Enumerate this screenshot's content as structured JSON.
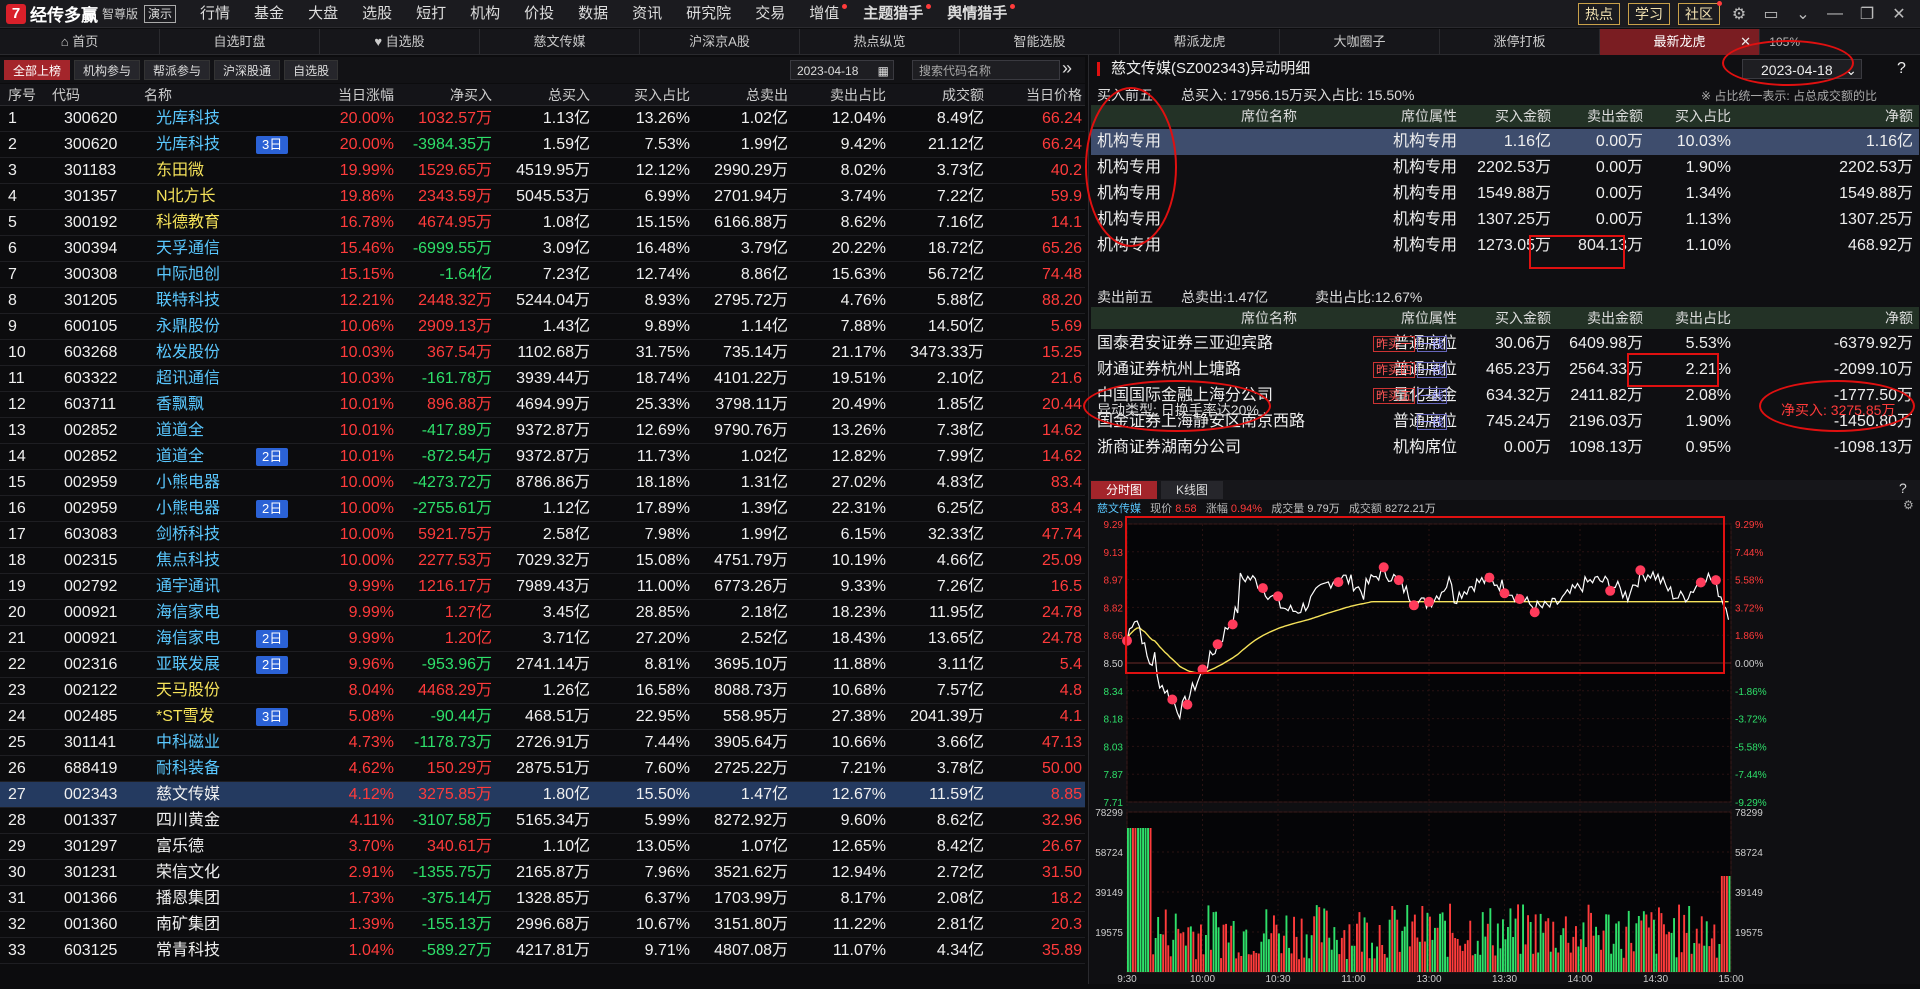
{
  "app": {
    "name": "经传多赢",
    "edition": "智尊版",
    "demo": "演示",
    "menu": [
      "行情",
      "基金",
      "大盘",
      "选股",
      "短打",
      "机构",
      "价投",
      "数据",
      "资讯",
      "研究院",
      "交易",
      "增值",
      "主题猎手",
      "舆情猎手"
    ],
    "menu_dot": [
      false,
      false,
      false,
      false,
      false,
      false,
      false,
      false,
      false,
      false,
      false,
      true,
      true,
      true
    ],
    "right_buttons": [
      "热点",
      "学习",
      "社区"
    ],
    "right_icons": [
      "gear-icon",
      "window-icon",
      "chevron-down-icon",
      "minimize-icon",
      "restore-icon",
      "close-icon"
    ]
  },
  "tabs": [
    "首页",
    "自选盯盘",
    "自选股",
    "慈文传媒",
    "沪深京A股",
    "热点纵览",
    "智能选股",
    "帮派龙虎",
    "大咖圈子",
    "涨停打板",
    "最新龙虎"
  ],
  "tab_icons": [
    "home-icon",
    "",
    "heart-icon",
    "",
    "",
    "",
    "",
    "",
    "",
    "",
    ""
  ],
  "active_tab": 10,
  "zoom": "105%",
  "left_toolbar": {
    "buttons": [
      "全部上榜",
      "机构参与",
      "帮派参与",
      "沪深股通",
      "自选股"
    ],
    "active": 0,
    "date": "2023-04-18",
    "search_placeholder": "搜索代码名称",
    "more": "»"
  },
  "table": {
    "columns": [
      "序号",
      "代码",
      "名称",
      "",
      "当日涨幅",
      "净买入",
      "总买入",
      "买入占比",
      "总卖出",
      "卖出占比",
      "成交额",
      "当日价格"
    ],
    "rows": [
      [
        "1",
        "300620",
        "光库科技",
        "",
        "20.00%",
        "1032.57万",
        "1.13亿",
        "13.26%",
        "1.02亿",
        "12.04%",
        "8.49亿",
        "66.24"
      ],
      [
        "2",
        "300620",
        "光库科技",
        "3日",
        "20.00%",
        "-3984.35万",
        "1.59亿",
        "7.53%",
        "1.99亿",
        "9.42%",
        "21.12亿",
        "66.24"
      ],
      [
        "3",
        "301183",
        "东田微",
        "",
        "19.99%",
        "1529.65万",
        "4519.95万",
        "12.12%",
        "2990.29万",
        "8.02%",
        "3.73亿",
        "40.2"
      ],
      [
        "4",
        "301357",
        "N北方长",
        "",
        "19.86%",
        "2343.59万",
        "5045.53万",
        "6.99%",
        "2701.94万",
        "3.74%",
        "7.22亿",
        "59.9"
      ],
      [
        "5",
        "300192",
        "科德教育",
        "",
        "16.78%",
        "4674.95万",
        "1.08亿",
        "15.15%",
        "6166.88万",
        "8.62%",
        "7.16亿",
        "14.1"
      ],
      [
        "6",
        "300394",
        "天孚通信",
        "",
        "15.46%",
        "-6999.55万",
        "3.09亿",
        "16.48%",
        "3.79亿",
        "20.22%",
        "18.72亿",
        "65.26"
      ],
      [
        "7",
        "300308",
        "中际旭创",
        "",
        "15.15%",
        "-1.64亿",
        "7.23亿",
        "12.74%",
        "8.86亿",
        "15.63%",
        "56.72亿",
        "74.48"
      ],
      [
        "8",
        "301205",
        "联特科技",
        "",
        "12.21%",
        "2448.32万",
        "5244.04万",
        "8.93%",
        "2795.72万",
        "4.76%",
        "5.88亿",
        "88.20"
      ],
      [
        "9",
        "600105",
        "永鼎股份",
        "",
        "10.06%",
        "2909.13万",
        "1.43亿",
        "9.89%",
        "1.14亿",
        "7.88%",
        "14.50亿",
        "5.69"
      ],
      [
        "10",
        "603268",
        "松发股份",
        "",
        "10.03%",
        "367.54万",
        "1102.68万",
        "31.75%",
        "735.14万",
        "21.17%",
        "3473.33万",
        "15.25"
      ],
      [
        "11",
        "603322",
        "超讯通信",
        "",
        "10.03%",
        "-161.78万",
        "3939.44万",
        "18.74%",
        "4101.22万",
        "19.51%",
        "2.10亿",
        "21.6"
      ],
      [
        "12",
        "603711",
        "香飘飘",
        "",
        "10.01%",
        "896.88万",
        "4694.99万",
        "25.33%",
        "3798.11万",
        "20.49%",
        "1.85亿",
        "20.44"
      ],
      [
        "13",
        "002852",
        "道道全",
        "",
        "10.01%",
        "-417.89万",
        "9372.87万",
        "12.69%",
        "9790.76万",
        "13.26%",
        "7.38亿",
        "14.62"
      ],
      [
        "14",
        "002852",
        "道道全",
        "2日",
        "10.01%",
        "-872.54万",
        "9372.87万",
        "11.73%",
        "1.02亿",
        "12.82%",
        "7.99亿",
        "14.62"
      ],
      [
        "15",
        "002959",
        "小熊电器",
        "",
        "10.00%",
        "-4273.72万",
        "8786.86万",
        "18.18%",
        "1.31亿",
        "27.02%",
        "4.83亿",
        "83.4"
      ],
      [
        "16",
        "002959",
        "小熊电器",
        "2日",
        "10.00%",
        "-2755.61万",
        "1.12亿",
        "17.89%",
        "1.39亿",
        "22.31%",
        "6.25亿",
        "83.4"
      ],
      [
        "17",
        "603083",
        "剑桥科技",
        "",
        "10.00%",
        "5921.75万",
        "2.58亿",
        "7.98%",
        "1.99亿",
        "6.15%",
        "32.33亿",
        "47.74"
      ],
      [
        "18",
        "002315",
        "焦点科技",
        "",
        "10.00%",
        "2277.53万",
        "7029.32万",
        "15.08%",
        "4751.79万",
        "10.19%",
        "4.66亿",
        "25.09"
      ],
      [
        "19",
        "002792",
        "通宇通讯",
        "",
        "9.99%",
        "1216.17万",
        "7989.43万",
        "11.00%",
        "6773.26万",
        "9.33%",
        "7.26亿",
        "16.5"
      ],
      [
        "20",
        "000921",
        "海信家电",
        "",
        "9.99%",
        "1.27亿",
        "3.45亿",
        "28.85%",
        "2.18亿",
        "18.23%",
        "11.95亿",
        "24.78"
      ],
      [
        "21",
        "000921",
        "海信家电",
        "2日",
        "9.99%",
        "1.20亿",
        "3.71亿",
        "27.20%",
        "2.52亿",
        "18.43%",
        "13.65亿",
        "24.78"
      ],
      [
        "22",
        "002316",
        "亚联发展",
        "2日",
        "9.96%",
        "-953.96万",
        "2741.14万",
        "8.81%",
        "3695.10万",
        "11.88%",
        "3.11亿",
        "5.4"
      ],
      [
        "23",
        "002122",
        "天马股份",
        "",
        "8.04%",
        "4468.29万",
        "1.26亿",
        "16.58%",
        "8088.73万",
        "10.68%",
        "7.57亿",
        "4.8"
      ],
      [
        "24",
        "002485",
        "*ST雪发",
        "3日",
        "5.08%",
        "-90.44万",
        "468.51万",
        "22.95%",
        "558.95万",
        "27.38%",
        "2041.39万",
        "4.1"
      ],
      [
        "25",
        "301141",
        "中科磁业",
        "",
        "4.73%",
        "-1178.73万",
        "2726.91万",
        "7.44%",
        "3905.64万",
        "10.66%",
        "3.66亿",
        "47.13"
      ],
      [
        "26",
        "688419",
        "耐科装备",
        "",
        "4.62%",
        "150.29万",
        "2875.51万",
        "7.60%",
        "2725.22万",
        "7.21%",
        "3.78亿",
        "50.00"
      ],
      [
        "27",
        "002343",
        "慈文传媒",
        "",
        "4.12%",
        "3275.85万",
        "1.80亿",
        "15.50%",
        "1.47亿",
        "12.67%",
        "11.59亿",
        "8.85"
      ],
      [
        "28",
        "001337",
        "四川黄金",
        "",
        "4.11%",
        "-3107.58万",
        "5165.34万",
        "5.99%",
        "8272.92万",
        "9.60%",
        "8.62亿",
        "32.96"
      ],
      [
        "29",
        "301297",
        "富乐德",
        "",
        "3.70%",
        "340.61万",
        "1.10亿",
        "13.05%",
        "1.07亿",
        "12.65%",
        "8.42亿",
        "26.67"
      ],
      [
        "30",
        "301231",
        "荣信文化",
        "",
        "2.91%",
        "-1355.75万",
        "2165.87万",
        "7.96%",
        "3521.62万",
        "12.94%",
        "2.72亿",
        "31.50"
      ],
      [
        "31",
        "001366",
        "播恩集团",
        "",
        "1.73%",
        "-375.14万",
        "1328.85万",
        "6.37%",
        "1703.99万",
        "8.17%",
        "2.08亿",
        "18.2"
      ],
      [
        "32",
        "001360",
        "南矿集团",
        "",
        "1.39%",
        "-155.13万",
        "2996.68万",
        "10.67%",
        "3151.80万",
        "11.22%",
        "2.81亿",
        "20.3"
      ],
      [
        "33",
        "603125",
        "常青科技",
        "",
        "1.04%",
        "-589.27万",
        "4217.81万",
        "9.71%",
        "4807.08万",
        "11.07%",
        "4.34亿",
        "35.89"
      ]
    ],
    "selected_row": 26
  },
  "detail": {
    "title": "慈文传媒(SZ002343)异动明细",
    "date": "2023-04-18",
    "buy_label": "买入前五",
    "buy_summary": "总买入: 17956.15万买入占比: 15.50%",
    "legend_note": "※ 占比统一表示: 占总成交额的比",
    "buy_columns": [
      "席位名称",
      "席位属性",
      "买入金额",
      "卖出金额",
      "买入占比",
      "净额"
    ],
    "buy_rows": [
      [
        "机构专用",
        "机构专用",
        "1.16亿",
        "0.00万",
        "10.03%",
        "1.16亿"
      ],
      [
        "机构专用",
        "机构专用",
        "2202.53万",
        "0.00万",
        "1.90%",
        "2202.53万"
      ],
      [
        "机构专用",
        "机构专用",
        "1549.88万",
        "0.00万",
        "1.34%",
        "1549.88万"
      ],
      [
        "机构专用",
        "机构专用",
        "1307.25万",
        "0.00万",
        "1.13%",
        "1307.25万"
      ],
      [
        "机构专用",
        "机构专用",
        "1273.05万",
        "804.13万",
        "1.10%",
        "468.92万"
      ]
    ],
    "sell_label": "卖出前五",
    "sell_total": "总卖出:1.47亿",
    "sell_ratio": "卖出占比:12.67%",
    "sell_columns": [
      "席位名称",
      "席位属性",
      "买入金额",
      "卖出金额",
      "卖出占比",
      "净额"
    ],
    "sell_rows": [
      [
        "国泰君安证券三亚迎宾路",
        "普通席位",
        "30.06万",
        "6409.98万",
        "5.53%",
        "-6379.92万"
      ],
      [
        "财通证券杭州上塘路",
        "普通席位",
        "465.23万",
        "2564.33万",
        "2.21%",
        "-2099.10万"
      ],
      [
        "中国国际金融上海分公司",
        "量化基金",
        "634.32万",
        "2411.82万",
        "2.08%",
        "-1777.50万"
      ],
      [
        "国金证券上海静安区南京西路",
        "普通席位",
        "745.24万",
        "2196.03万",
        "1.90%",
        "-1450.80万"
      ],
      [
        "浙商证券湖南分公司",
        "机构席位",
        "0.00万",
        "1098.13万",
        "0.95%",
        "-1098.13万"
      ]
    ],
    "sell_tags": [
      [
        "昨买一",
        "一线"
      ],
      [
        "昨买四",
        "一线"
      ],
      [
        "昨买五",
        "一线"
      ],
      [
        "一线"
      ],
      []
    ],
    "anomaly": "异动类型: 日换手率达20%",
    "net_buy": "净买入: 3275.85万"
  },
  "chart": {
    "tabs": [
      "分时图",
      "K线图"
    ],
    "stock": "慈文传媒",
    "price_label": "现价",
    "price": "8.58",
    "chg_label": "涨幅",
    "chg": "0.94%",
    "vol_label": "成交量",
    "vol": "9.79万",
    "amt_label": "成交额",
    "amt": "8272.21万",
    "price_ticks": [
      "9.29",
      "9.13",
      "8.97",
      "8.82",
      "8.66",
      "8.50",
      "8.34",
      "8.18",
      "8.03",
      "7.87",
      "7.71"
    ],
    "pct_ticks": [
      "9.29%",
      "7.44%",
      "5.58%",
      "3.72%",
      "1.86%",
      "0.00%",
      "-1.86%",
      "-3.72%",
      "-5.58%",
      "-7.44%",
      "-9.29%"
    ],
    "vol_ticks": [
      "78299",
      "58724",
      "39149",
      "19575"
    ],
    "time_ticks": [
      "9:30",
      "10:00",
      "10:30",
      "11:00",
      "13:00",
      "13:30",
      "14:00",
      "14:30",
      "15:00"
    ],
    "colors": {
      "price_line": "#ffffff",
      "avg_line": "#f5e25a",
      "up": "#ff3b3b",
      "down": "#2ee06a",
      "marker": "#ff3b5b"
    }
  }
}
